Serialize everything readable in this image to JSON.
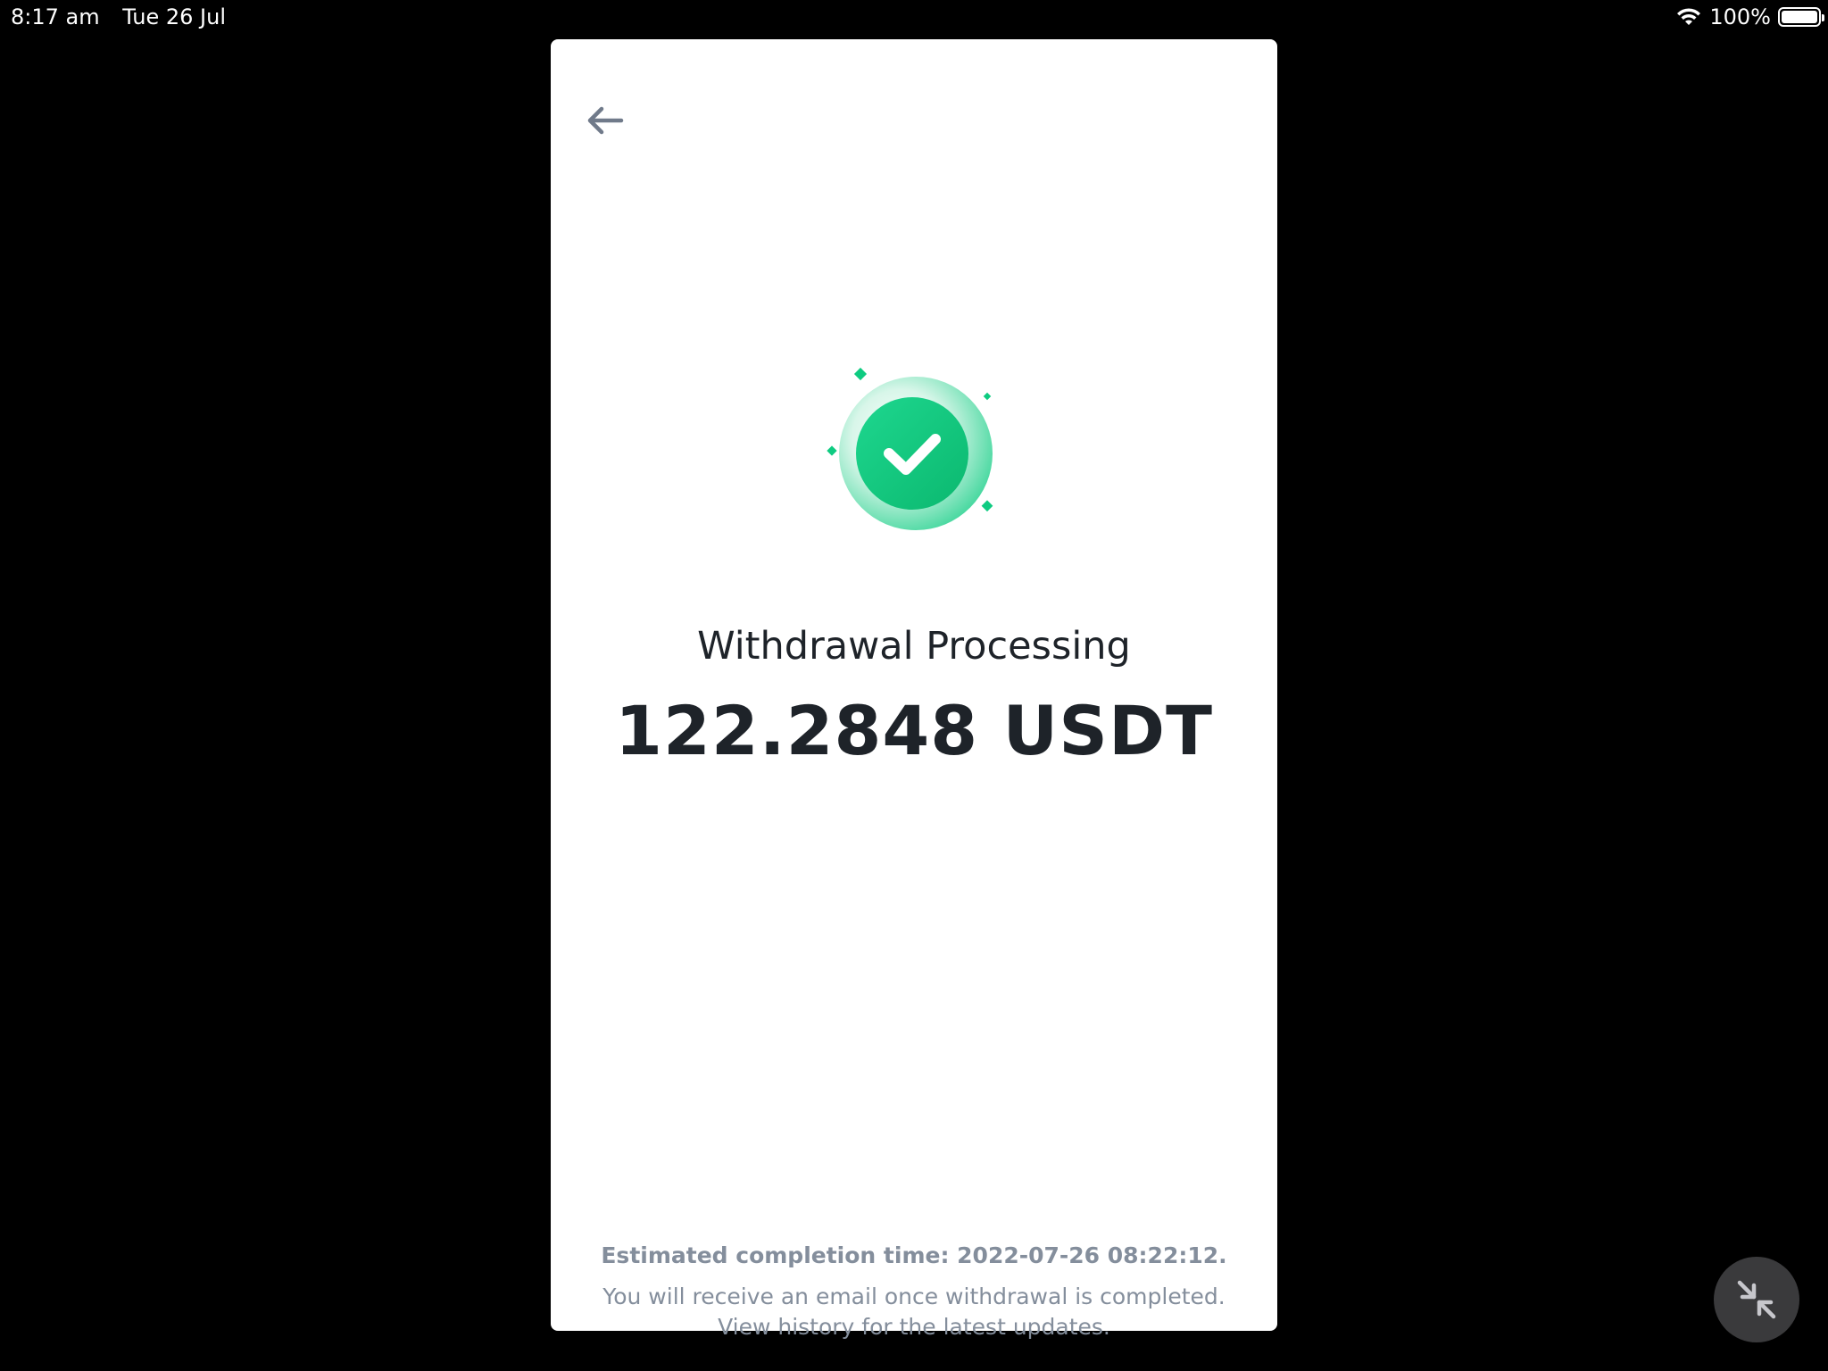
{
  "status_bar": {
    "time": "8:17 am",
    "date": "Tue 26 Jul",
    "battery_percent": "100%",
    "icons": [
      "wifi-icon",
      "battery-icon"
    ]
  },
  "app": {
    "back_icon": "arrow-left-icon",
    "status_icon": "check-circle-icon",
    "title": "Withdrawal Processing",
    "amount": "122.2848 USDT",
    "estimated_completion": "Estimated completion time: 2022-07-26 08:22:12.",
    "notice_line1": "You will receive an email once withdrawal is completed.",
    "notice_line2": "View history for the latest updates.",
    "accent_color": "#0ecb81"
  },
  "overlay": {
    "minimize_icon": "minimize-arrows-icon"
  }
}
